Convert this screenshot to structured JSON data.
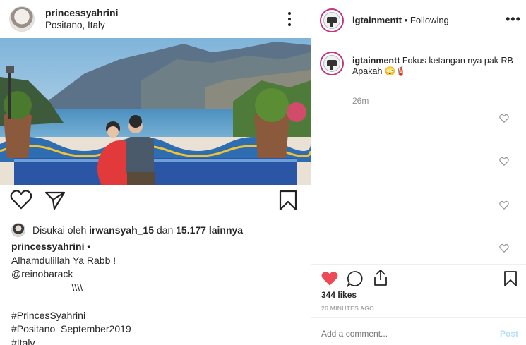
{
  "post": {
    "username": "princessyahrini",
    "location": "Positano, Italy",
    "liked_by_prefix": "Disukai oleh",
    "liked_by_user": "irwansyah_15",
    "liked_by_joiner": "dan",
    "liked_by_others": "15.177 lainnya",
    "caption_author": "princessyahrini •",
    "caption_lines": [
      "Alhamdulillah Ya Rabb !",
      "@reinobarack",
      "___________\\\\\\\\___________",
      "",
      "#PrincesSyahrini",
      "#Positano_September2019",
      "#Italy"
    ]
  },
  "panel": {
    "account": "igtainmentt",
    "separator": "•",
    "follow_status": "Following",
    "more_label": "•••",
    "comment_user": "igtainmentt",
    "comment_text": "Fokus ketangan nya pak RB",
    "comment_text2": "Apakah 😳🧯",
    "comment_time": "26m",
    "likes": "344 likes",
    "time_ago": "26 MINUTES AGO",
    "comment_placeholder": "Add a comment...",
    "post_label": "Post"
  },
  "colors": {
    "like_red": "#ed4956",
    "text": "#262626",
    "muted": "#8e8e8e",
    "post_blue_disabled": "#b2dffc"
  },
  "icons": {
    "left_actions": [
      "heart-outline-icon",
      "share-icon",
      "bookmark-icon"
    ],
    "right_actions": [
      "heart-filled-icon",
      "comment-icon",
      "share-upload-icon",
      "bookmark-icon"
    ]
  }
}
